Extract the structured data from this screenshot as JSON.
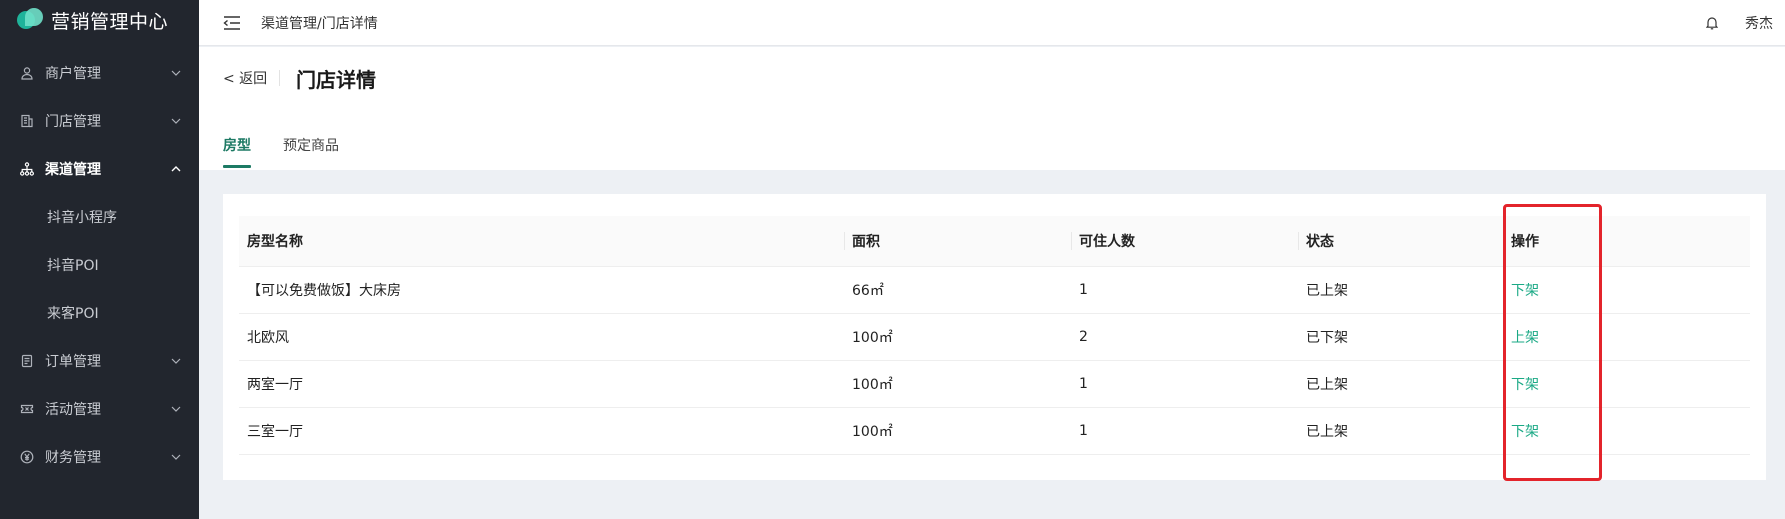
{
  "app": {
    "title": "营销管理中心"
  },
  "sidebar": {
    "items": [
      {
        "label": "商户管理",
        "icon": "user-icon",
        "expanded": false
      },
      {
        "label": "门店管理",
        "icon": "building-icon",
        "expanded": false
      },
      {
        "label": "渠道管理",
        "icon": "network-icon",
        "expanded": true,
        "children": [
          {
            "label": "抖音小程序"
          },
          {
            "label": "抖音POI"
          },
          {
            "label": "来客POI"
          }
        ]
      },
      {
        "label": "订单管理",
        "icon": "order-icon",
        "expanded": false
      },
      {
        "label": "活动管理",
        "icon": "ticket-icon",
        "expanded": false
      },
      {
        "label": "财务管理",
        "icon": "yen-coin-icon",
        "expanded": false
      }
    ]
  },
  "header": {
    "breadcrumb": "渠道管理/门店详情",
    "user": "秀杰"
  },
  "page": {
    "back_label": "< 返回",
    "title": "门店详情",
    "tabs": [
      {
        "label": "房型",
        "active": true
      },
      {
        "label": "预定商品",
        "active": false
      }
    ]
  },
  "table": {
    "columns": [
      "房型名称",
      "面积",
      "可住人数",
      "状态",
      "操作"
    ],
    "rows": [
      {
        "name": "【可以免费做饭】大床房",
        "area": "66㎡",
        "capacity": "1",
        "status": "已上架",
        "action": "下架"
      },
      {
        "name": "北欧风",
        "area": "100㎡",
        "capacity": "2",
        "status": "已下架",
        "action": "上架"
      },
      {
        "name": "两室一厅",
        "area": "100㎡",
        "capacity": "1",
        "status": "已上架",
        "action": "下架"
      },
      {
        "name": "三室一厅",
        "area": "100㎡",
        "capacity": "1",
        "status": "已上架",
        "action": "下架"
      }
    ]
  },
  "colors": {
    "sidebar_bg": "#22262e",
    "accent": "#1d7a64",
    "link": "#1aa985",
    "highlight": "#e3242b"
  }
}
